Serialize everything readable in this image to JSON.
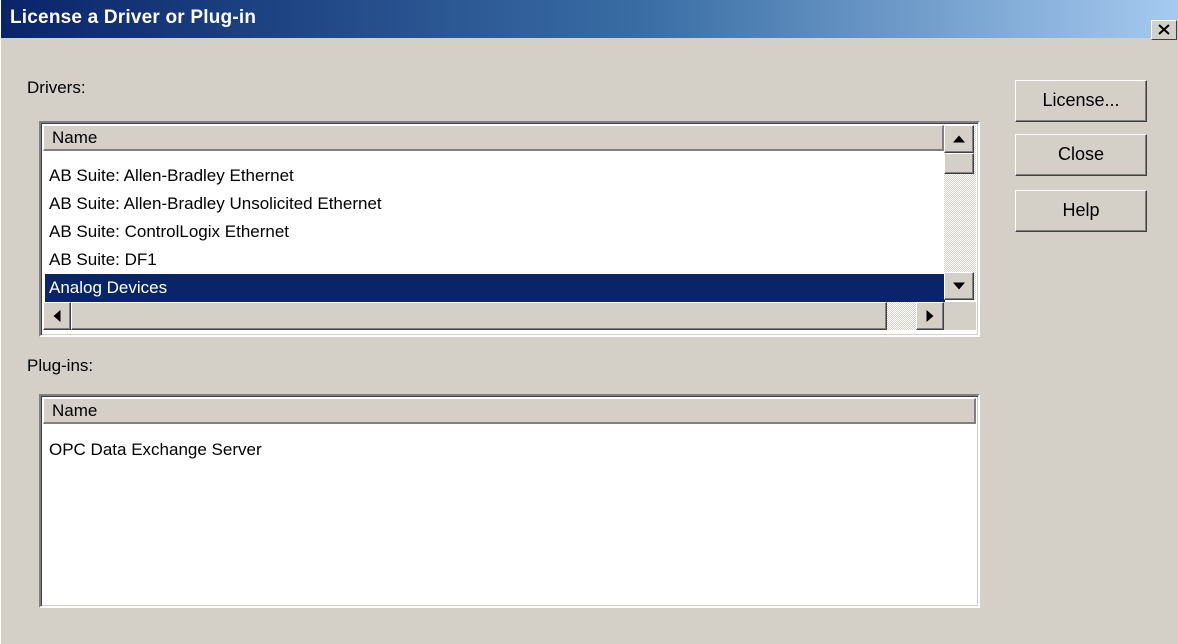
{
  "window": {
    "title": "License a Driver or Plug-in"
  },
  "drivers": {
    "label": "Drivers:",
    "column_header": "Name",
    "items": [
      "AB Suite: Allen-Bradley Ethernet",
      "AB Suite: Allen-Bradley Unsolicited Ethernet",
      "AB Suite: ControlLogix Ethernet",
      "AB Suite: DF1",
      "Analog Devices"
    ],
    "selected_item": "Analog Devices"
  },
  "plugins": {
    "label": "Plug-ins:",
    "column_header": "Name",
    "items": [
      "OPC Data Exchange Server"
    ]
  },
  "buttons": {
    "license": "License...",
    "close": "Close",
    "help": "Help"
  },
  "icons": {
    "close": "close-icon",
    "scroll_up": "arrow-up-icon",
    "scroll_down": "arrow-down-icon",
    "scroll_left": "arrow-left-icon",
    "scroll_right": "arrow-right-icon"
  },
  "colors": {
    "title_gradient_start": "#0a246a",
    "title_gradient_end": "#a6caf0",
    "selection": "#0a246a",
    "face": "#d4d0c8"
  }
}
